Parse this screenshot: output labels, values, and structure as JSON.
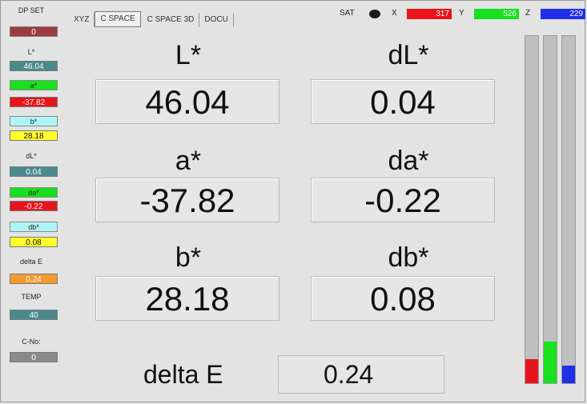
{
  "sidebar": {
    "dp_set": {
      "label": "DP SET",
      "value": "0"
    },
    "l": {
      "label": "L*",
      "value": "46.04"
    },
    "a": {
      "label": "a*",
      "value": "-37.82"
    },
    "b": {
      "label": "b*",
      "value": "28.18"
    },
    "dl": {
      "label": "dL*",
      "value": "0.04"
    },
    "da": {
      "label": "da*",
      "value": "-0.22"
    },
    "db": {
      "label": "db*",
      "value": "0.08"
    },
    "delta_e": {
      "label": "delta E",
      "value": "0.24"
    },
    "temp": {
      "label": "TEMP",
      "value": "40"
    },
    "c_no": {
      "label": "C-No:",
      "value": "0"
    }
  },
  "tabs": [
    {
      "label": "XYZ"
    },
    {
      "label": "C SPACE"
    },
    {
      "label": "C SPACE 3D"
    },
    {
      "label": "DOCU"
    }
  ],
  "sat": {
    "label": "SAT",
    "x_label": "X",
    "x_value": "317",
    "y_label": "Y",
    "y_value": "526",
    "z_label": "Z",
    "z_value": "229"
  },
  "main": {
    "l_label": "L*",
    "l_value": "46.04",
    "dl_label": "dL*",
    "dl_value": "0.04",
    "a_label": "a*",
    "a_value": "-37.82",
    "da_label": "da*",
    "da_value": "-0.22",
    "b_label": "b*",
    "b_value": "28.18",
    "db_label": "db*",
    "db_value": "0.08",
    "delta_e_label": "delta E",
    "delta_e_value": "0.24"
  },
  "bars": [
    {
      "name": "x",
      "level": 0.07,
      "color": "#e8141b"
    },
    {
      "name": "y",
      "level": 0.12,
      "color": "#18e01e"
    },
    {
      "name": "z",
      "level": 0.05,
      "color": "#1f2fe8"
    }
  ],
  "colors": {
    "red": "#e8141b",
    "green": "#18e01e",
    "blue": "#1f2fe8",
    "teal_value": "#4a8a8d",
    "cyan_chip": "#aef5f7",
    "yellow_value": "#ffff2a",
    "orange_value": "#f39a2e",
    "maroon_value": "#9b3b3f",
    "gray_value": "#8a8a8a"
  }
}
